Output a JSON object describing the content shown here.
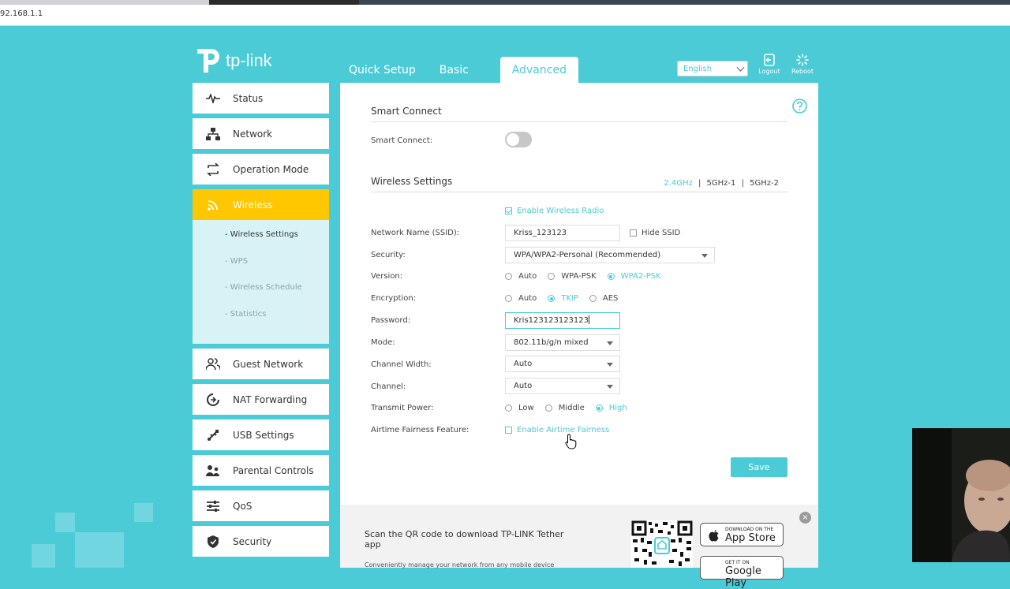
{
  "browser": {
    "url": "92.168.1.1"
  },
  "brand": {
    "name": "tp-link",
    "accent": "#4acbd6",
    "highlight": "#ffc700"
  },
  "topnav": {
    "tabs": [
      "Quick Setup",
      "Basic",
      "Advanced"
    ],
    "active": "Advanced"
  },
  "language": {
    "selected": "English"
  },
  "topicons": {
    "logout": "Logout",
    "reboot": "Reboot"
  },
  "sidebar": {
    "items": [
      {
        "label": "Status",
        "icon": "pulse-icon"
      },
      {
        "label": "Network",
        "icon": "network-icon"
      },
      {
        "label": "Operation Mode",
        "icon": "mode-icon"
      },
      {
        "label": "Wireless",
        "icon": "wifi-icon"
      },
      {
        "label": "Guest Network",
        "icon": "guests-icon"
      },
      {
        "label": "NAT Forwarding",
        "icon": "nat-icon"
      },
      {
        "label": "USB Settings",
        "icon": "usb-icon"
      },
      {
        "label": "Parental Controls",
        "icon": "parental-icon"
      },
      {
        "label": "QoS",
        "icon": "qos-icon"
      },
      {
        "label": "Security",
        "icon": "shield-icon"
      }
    ],
    "wireless_sub": [
      "- Wireless Settings",
      "- WPS",
      "- Wireless Schedule",
      "- Statistics"
    ]
  },
  "smart_connect": {
    "title": "Smart Connect",
    "label": "Smart Connect:",
    "enabled": false
  },
  "wireless": {
    "title": "Wireless Settings",
    "bands": [
      "2.4GHz",
      "5GHz-1",
      "5GHz-2"
    ],
    "band_sep": "|",
    "enable_radio": "Enable Wireless Radio",
    "ssid_label": "Network Name (SSID):",
    "ssid": "Kriss_123123",
    "hide_ssid": "Hide SSID",
    "security_label": "Security:",
    "security": "WPA/WPA2-Personal (Recommended)",
    "version_label": "Version:",
    "version_options": [
      "Auto",
      "WPA-PSK",
      "WPA2-PSK"
    ],
    "encryption_label": "Encryption:",
    "encryption_options": [
      "Auto",
      "TKIP",
      "AES"
    ],
    "password_label": "Password:",
    "password": "Kris123123123123",
    "mode_label": "Mode:",
    "mode": "802.11b/g/n mixed",
    "width_label": "Channel Width:",
    "width": "Auto",
    "channel_label": "Channel:",
    "channel": "Auto",
    "power_label": "Transmit Power:",
    "power_options": [
      "Low",
      "Middle",
      "High"
    ],
    "airtime_label": "Airtime Fairness Feature:",
    "airtime": "Enable Airtime Fairness",
    "save": "Save"
  },
  "footer": {
    "scan_text": "Scan the QR code to download TP-LINK Tether app",
    "sub_text": "Conveniently manage your network from any mobile device",
    "appstore_small": "DOWNLOAD ON THE",
    "appstore_big": "App Store",
    "google_small": "GET IT ON",
    "google_big": "Google Play",
    "close": "×"
  }
}
